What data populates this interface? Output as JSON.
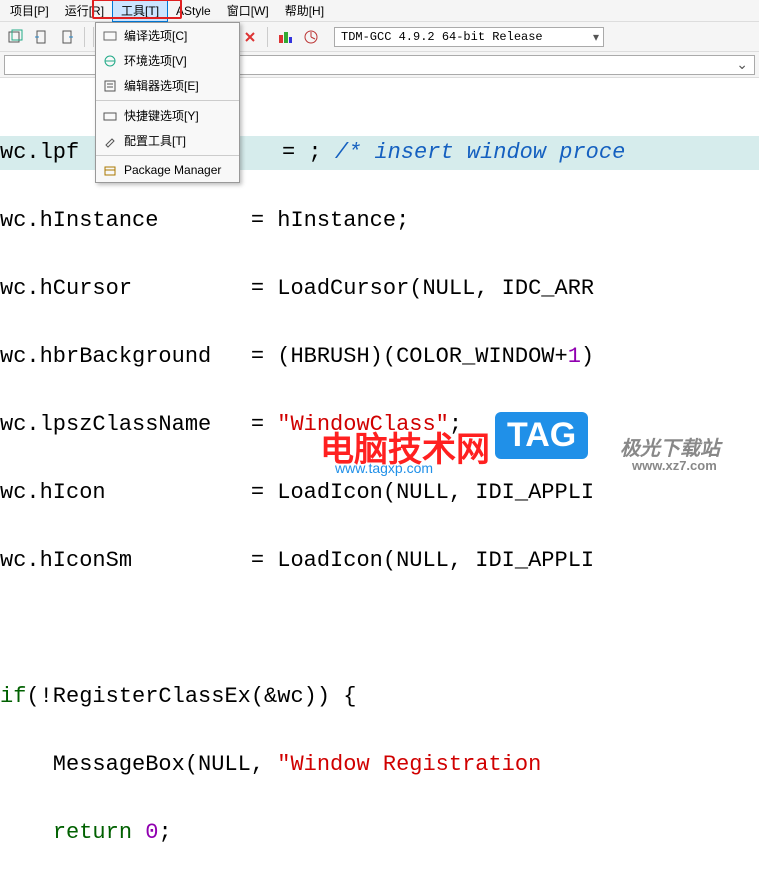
{
  "menubar": {
    "project": "项目[P]",
    "run": "运行[R]",
    "tools": "工具[T]",
    "astyle": "AStyle",
    "window": "窗口[W]",
    "help": "帮助[H]"
  },
  "dropdown": {
    "compile_opts": "编译选项[C]",
    "env_opts": "环境选项[V]",
    "editor_opts": "编辑器选项[E]",
    "shortcut_opts": "快捷键选项[Y]",
    "config_tool": "配置工具[T]",
    "package_manager": "Package Manager"
  },
  "compiler": "TDM-GCC 4.9.2 64-bit Release",
  "code": {
    "l1_a": "wc.lpf",
    "l1_b": "    = ; ",
    "l1_c": "/* insert window proce",
    "l2": "wc.hInstance       = hInstance;",
    "l3": "wc.hCursor         = LoadCursor(NULL, IDC_ARR",
    "l4_a": "wc.hbrBackground   = (HBRUSH)(COLOR_WINDOW+",
    "l4_b": "1",
    "l4_c": ")",
    "l5_a": "wc.lpszClassName   = ",
    "l5_b": "\"WindowClass\"",
    "l5_c": ";",
    "l6": "wc.hIcon           = LoadIcon(NULL, IDI_APPLI",
    "l7": "wc.hIconSm         = LoadIcon(NULL, IDI_APPLI",
    "l8": "",
    "l9_a": "if",
    "l9_b": "(!RegisterClassEx(&wc)) {",
    "l10_a": "    MessageBox(NULL, ",
    "l10_b": "\"Window Registration ",
    "l11_a": "    ",
    "l11_b": "return",
    "l11_c": " 0",
    "l11_d": ";"
  },
  "watermarks": {
    "red": "电脑技术网",
    "tag": "TAG",
    "tagxp": "www.tagxp.com",
    "xz_top": "极光下载站",
    "xz_url": "www.xz7.com"
  }
}
